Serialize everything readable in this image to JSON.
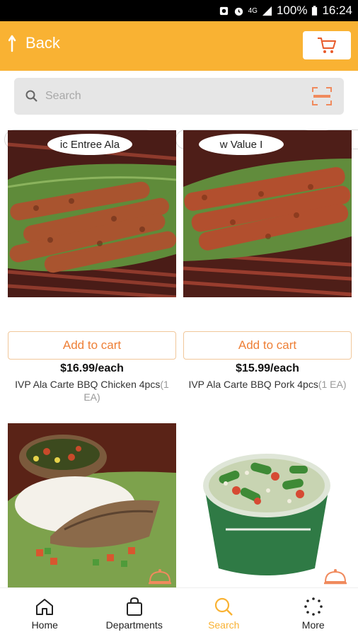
{
  "status_bar": {
    "battery": "100%",
    "time": "16:24",
    "network": "4G"
  },
  "appbar": {
    "back_label": "Back",
    "cart_icon": "cart-icon",
    "accent": "#f9b233"
  },
  "search": {
    "placeholder": "Search"
  },
  "products": [
    {
      "tag": "ic Entree Ala",
      "add_label": "Add to cart",
      "price": "$16.99/each",
      "name": "IVP Ala Carte BBQ Chicken 4pcs",
      "qty": "(1 EA)"
    },
    {
      "tag": "w Value I",
      "add_label": "Add to cart",
      "price": "$15.99/each",
      "name": "IVP Ala Carte BBQ Pork 4pcs",
      "qty": "(1 EA)"
    },
    {
      "image": "fish-rice-plate"
    },
    {
      "image": "salad-bowl"
    }
  ],
  "tabbar": {
    "items": [
      {
        "label": "Home",
        "icon": "home-icon"
      },
      {
        "label": "Departments",
        "icon": "bag-icon"
      },
      {
        "label": "Search",
        "icon": "search-icon",
        "active": true
      },
      {
        "label": "More",
        "icon": "more-icon"
      }
    ],
    "active_color": "#f9b233"
  }
}
